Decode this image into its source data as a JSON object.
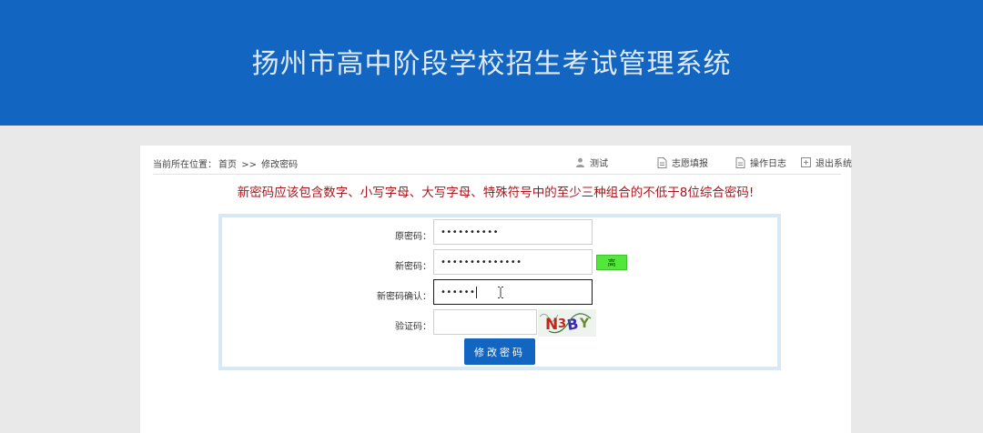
{
  "header": {
    "title": "扬州市高中阶段学校招生考试管理系统"
  },
  "breadcrumb": {
    "prefix": "当前所在位置：",
    "home": "首页",
    "separator": ">>",
    "current": "修改密码"
  },
  "topnav": {
    "user": "测试",
    "apply": "志愿填报",
    "log": "操作日志",
    "logout": "退出系统"
  },
  "notice": "新密码应该包含数字、小写字母、大写字母、特殊符号中的至少三种组合的不低于8位综合密码!",
  "form": {
    "old_password": {
      "label": "原密码：",
      "value": "••••••••••"
    },
    "new_password": {
      "label": "新密码：",
      "value": "••••••••••••••",
      "strength": "高"
    },
    "confirm_password": {
      "label": "新密码确认：",
      "value": "••••••"
    },
    "captcha": {
      "label": "验证码：",
      "value": "",
      "image_text": "N3BY"
    },
    "submit_label": "修改密码"
  },
  "colors": {
    "header_bg": "#1266c2",
    "notice_text": "#a8161c",
    "strength_bg": "#53e63c",
    "button_bg": "#1266c2"
  }
}
